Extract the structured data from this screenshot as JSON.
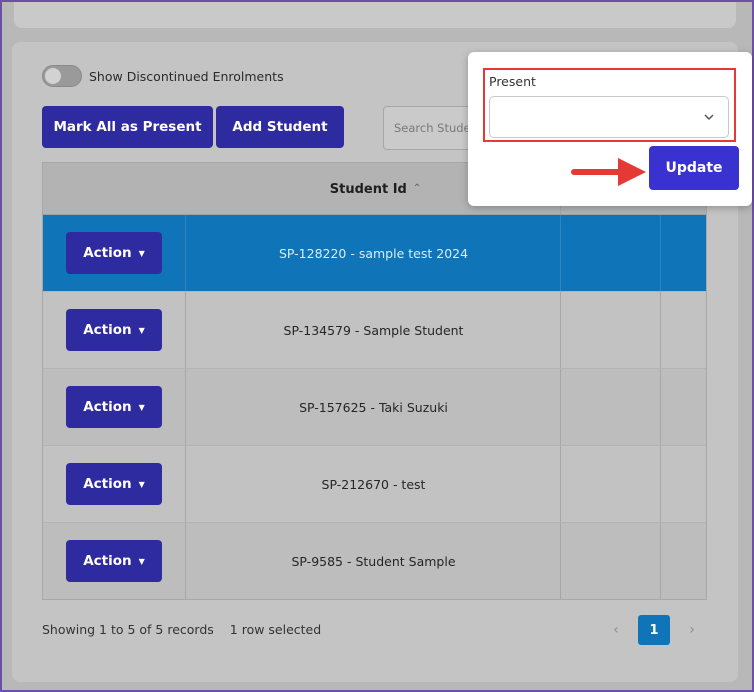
{
  "toolbar": {
    "toggle_label": "Show Discontinued Enrolments",
    "mark_all_label": "Mark All as Present",
    "add_student_label": "Add Student",
    "search_placeholder": "Search Stude"
  },
  "table": {
    "column_header": "Student Id",
    "action_label": "Action",
    "rows": [
      {
        "student": "SP-128220 - sample test 2024",
        "selected": true
      },
      {
        "student": "SP-134579 - Sample Student",
        "selected": false
      },
      {
        "student": "SP-157625 - Taki Suzuki",
        "selected": false
      },
      {
        "student": "SP-212670 - test",
        "selected": false
      },
      {
        "student": "SP-9585 - Student Sample",
        "selected": false
      }
    ]
  },
  "footer": {
    "records_text": "Showing 1 to 5 of 5 records",
    "selection_text": "1 row selected",
    "current_page": "1"
  },
  "popup": {
    "field_label": "Present",
    "selected_value": "",
    "update_label": "Update"
  },
  "colors": {
    "primary_button": "#2e2aa0",
    "update_button": "#3a32d0",
    "selected_row": "#0f74b8",
    "highlight": "#e53935"
  }
}
